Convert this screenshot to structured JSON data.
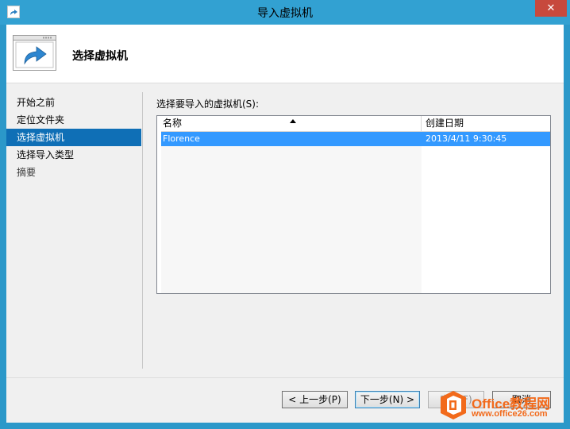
{
  "window": {
    "title": "导入虚拟机",
    "close_glyph": "✕"
  },
  "header": {
    "title": "选择虚拟机"
  },
  "nav": {
    "items": [
      {
        "label": "开始之前"
      },
      {
        "label": "定位文件夹"
      },
      {
        "label": "选择虚拟机"
      },
      {
        "label": "选择导入类型"
      },
      {
        "label": "摘要"
      }
    ]
  },
  "main": {
    "list_label": "选择要导入的虚拟机(S):",
    "columns": [
      "名称",
      "创建日期"
    ],
    "rows": [
      {
        "name": "Florence",
        "created": "2013/4/11 9:30:45"
      }
    ]
  },
  "footer": {
    "prev_label": "< 上一步(P)",
    "next_label": "下一步(N) >",
    "finish_label": "完成(F)",
    "cancel_label": "取消"
  },
  "watermark": {
    "line1": "Office教程网",
    "line2": "www.office26.com"
  },
  "colors": {
    "titlebar": "#32a1d2",
    "selection": "#3399ff",
    "nav_active": "#0f6fb6",
    "close": "#c7493d",
    "watermark": "#f26a1b"
  },
  "icons": {
    "app": "import-arrow-icon",
    "header": "import-arrow-icon"
  }
}
